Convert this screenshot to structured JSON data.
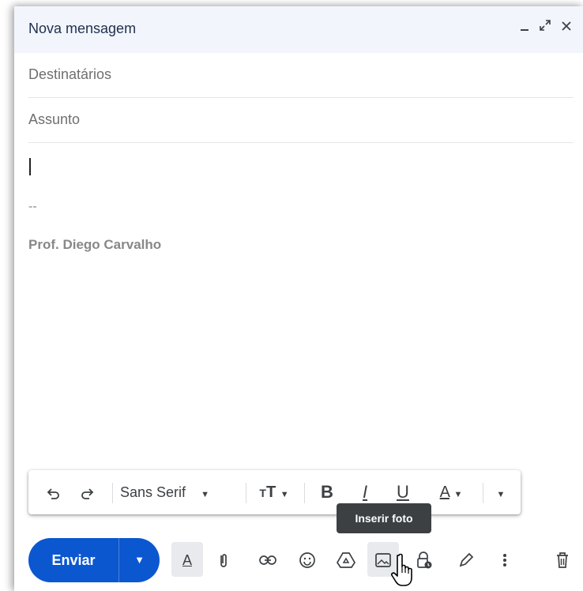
{
  "window": {
    "title": "Nova mensagem",
    "controls": {
      "minimize_icon": "minimize-icon",
      "expand_icon": "expand-icon",
      "close_icon": "close-icon"
    }
  },
  "fields": {
    "recipients_placeholder": "Destinatários",
    "subject_placeholder": "Assunto"
  },
  "body": {
    "signature_separator": "--",
    "signature_name": "Prof. Diego Carvalho"
  },
  "format_toolbar": {
    "undo_icon": "undo-icon",
    "redo_icon": "redo-icon",
    "font_family": "Sans Serif",
    "font_size_icon": "text-size-icon",
    "bold_label": "B",
    "italic_label": "I",
    "underline_label": "U",
    "text_color_label": "A",
    "more_icon": "more-formatting-icon"
  },
  "tooltip": {
    "text": "Inserir foto"
  },
  "bottom_toolbar": {
    "send_label": "Enviar",
    "send_options_icon": "chevron-down-icon",
    "formatting_label": "A",
    "icons": [
      "paperclip-icon",
      "link-icon",
      "emoji-icon",
      "drive-icon",
      "photo-icon",
      "lock-clock-icon",
      "pen-icon",
      "more-vert-icon",
      "trash-icon"
    ]
  },
  "colors": {
    "accent": "#0b57d0",
    "titlebar_bg": "#f2f6fc",
    "tooltip_bg": "#3c4043"
  }
}
